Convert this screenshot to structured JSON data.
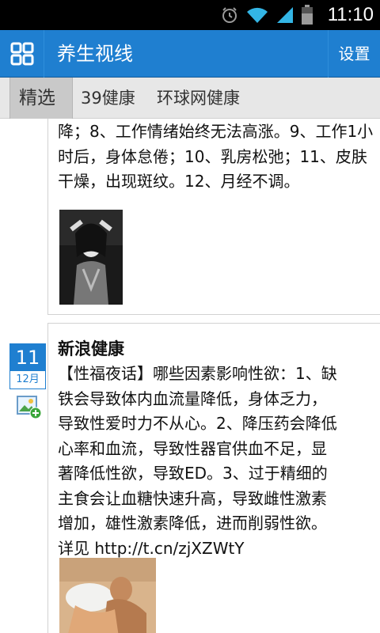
{
  "status_bar": {
    "time": "11:10"
  },
  "header": {
    "title": "养生视线",
    "settings_label": "设置"
  },
  "tabs": [
    {
      "label": "精选",
      "selected": true
    },
    {
      "label": "39健康",
      "selected": false
    },
    {
      "label": "环球网健康",
      "selected": false
    }
  ],
  "post1": {
    "text": "降；8、工作情绪始终无法高涨。9、工作1小时后，身体怠倦；10、乳房松弛；11、皮肤干燥，出现斑纹。12、月经不调。"
  },
  "post2": {
    "date_day": "11",
    "date_month": "12月",
    "source": "新浪健康",
    "text": "【性福夜话】哪些因素影响性欲：1、缺铁会导致体内血流量降低，身体乏力，导致性爱时力不从心。2、降压药会降低心率和血流，导致性器官供血不足，显著降低性欲，导致ED。3、过于精细的主食会让血糖快速升高，导致雌性激素增加，雄性激素降低，进而削弱性欲。详见 http://t.cn/zjXZWtY"
  },
  "colors": {
    "accent": "#1f7fd0",
    "status_bar": "#000000",
    "tab_bar": "#e7e7e7"
  },
  "icons": [
    "alarm-icon",
    "wifi-icon",
    "signal-icon",
    "battery-icon",
    "grid-menu-icon",
    "add-image-icon"
  ]
}
